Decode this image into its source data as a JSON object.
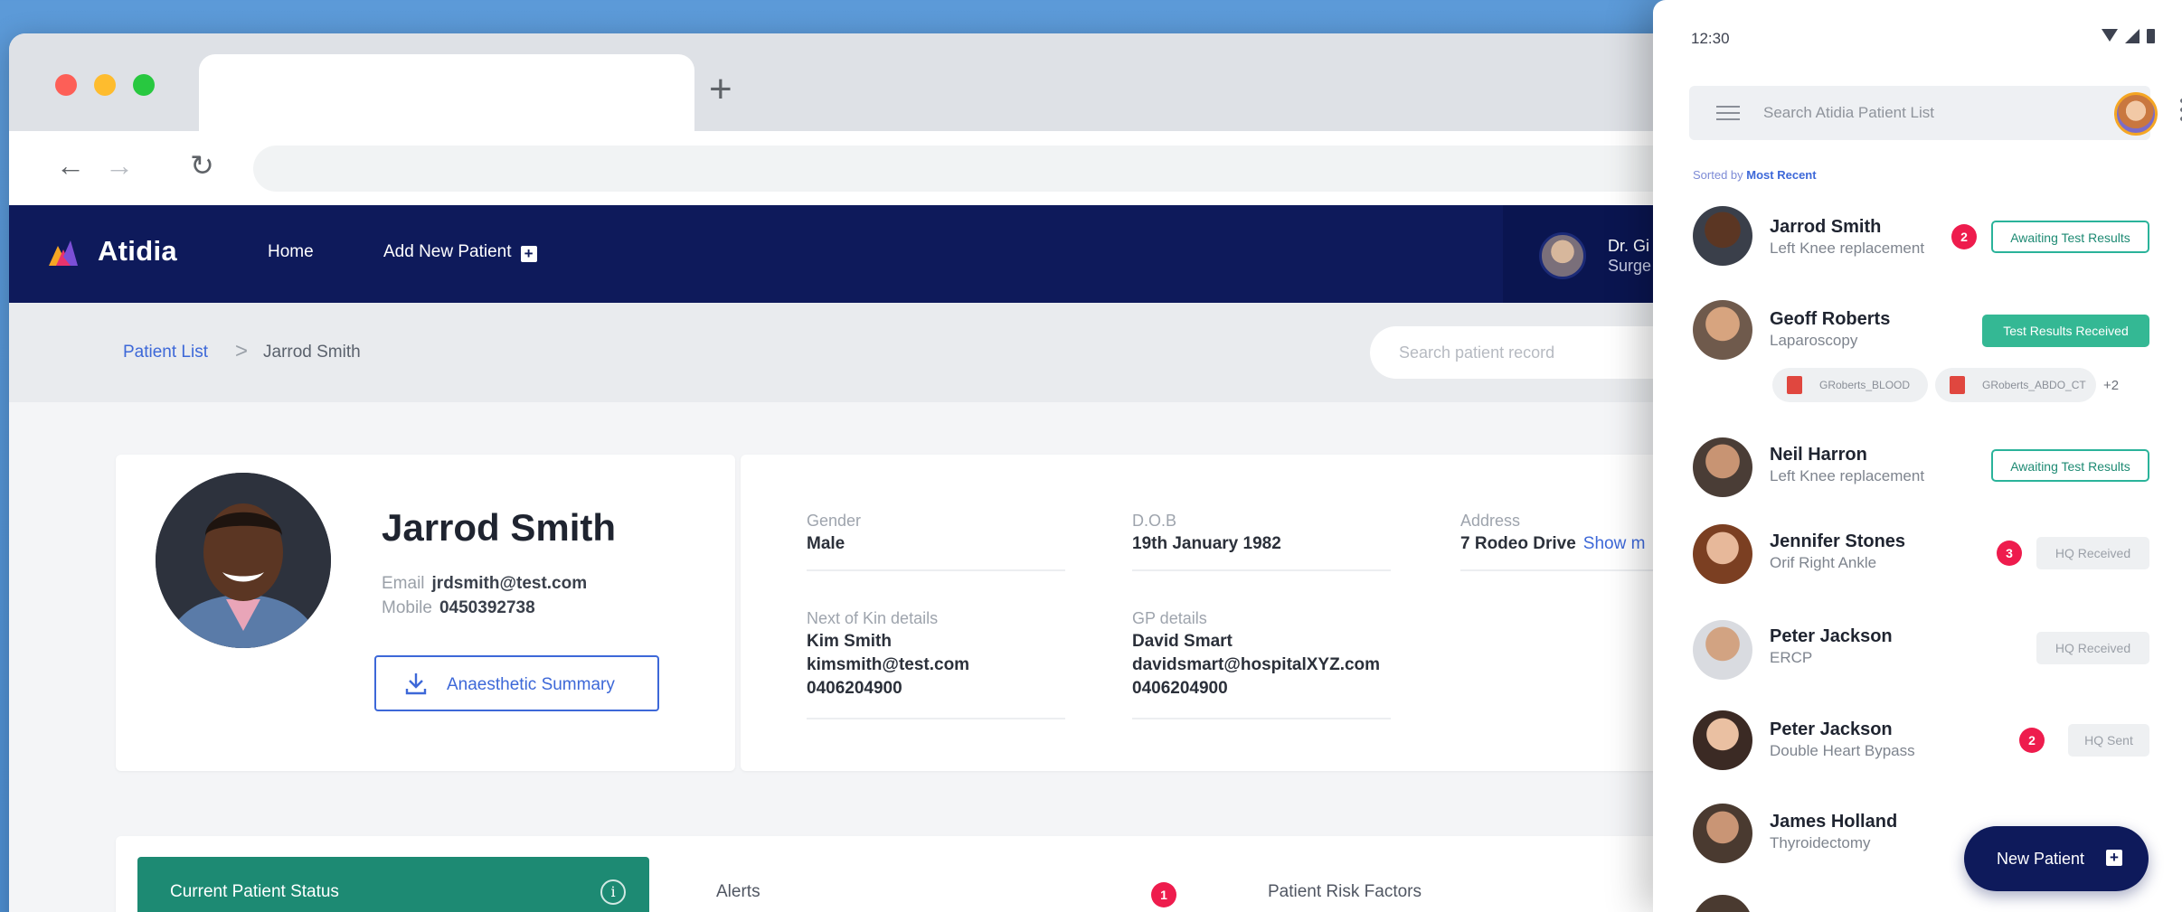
{
  "browser": {
    "new_tab": "+",
    "back": "←",
    "forward": "→",
    "reload": "↻"
  },
  "app": {
    "brand": "Atidia",
    "nav": {
      "home": "Home",
      "add_patient": "Add New Patient",
      "plus": "+"
    },
    "doctor": {
      "line1": "Dr. Gi",
      "line2": "Surge"
    }
  },
  "breadcrumb": {
    "root": "Patient List",
    "separator": ">",
    "current": "Jarrod Smith",
    "search_placeholder": "Search patient record"
  },
  "patient": {
    "name": "Jarrod Smith",
    "email_label": "Email",
    "email": "jrdsmith@test.com",
    "mobile_label": "Mobile",
    "mobile": "0450392738",
    "anaesthetic_button": "Anaesthetic Summary",
    "fields": {
      "gender_label": "Gender",
      "gender": "Male",
      "dob_label": "D.O.B",
      "dob": "19th January 1982",
      "address_label": "Address",
      "address": "7 Rodeo Drive",
      "show_more": "Show m",
      "kin_label": "Next of Kin details",
      "kin_name": "Kim Smith",
      "kin_email": "kimsmith@test.com",
      "kin_phone": "0406204900",
      "gp_label": "GP details",
      "gp_name": "David Smart",
      "gp_email": "davidsmart@hospitalXYZ.com",
      "gp_phone": "0406204900"
    }
  },
  "panels": {
    "status": "Current Patient Status",
    "info_icon": "i",
    "alerts": "Alerts",
    "alerts_count": "1",
    "risk": "Patient Risk Factors"
  },
  "mobile": {
    "time": "12:30",
    "search_placeholder": "Search Atidia Patient List",
    "sort_prefix": "Sorted by",
    "sort_value": "Most Recent",
    "patients": [
      {
        "name": "Jarrod Smith",
        "procedure": "Left Knee replacement",
        "badge": "2",
        "status": "Awaiting Test Results"
      },
      {
        "name": "Geoff Roberts",
        "procedure": "Laparoscopy",
        "status": "Test Results Received",
        "files": [
          "GRoberts_BLOOD",
          "GRoberts_ABDO_CT"
        ],
        "more_files": "+2"
      },
      {
        "name": "Neil Harron",
        "procedure": "Left Knee replacement",
        "status": "Awaiting Test Results"
      },
      {
        "name": "Jennifer Stones",
        "procedure": "Orif Right Ankle",
        "badge": "3",
        "status": "HQ Received"
      },
      {
        "name": "Peter Jackson",
        "procedure": "ERCP",
        "status": "HQ Received"
      },
      {
        "name": "Peter Jackson",
        "procedure": "Double Heart Bypass",
        "badge": "2",
        "status": "HQ Sent"
      },
      {
        "name": "James Holland",
        "procedure": "Thyroidectomy"
      }
    ],
    "fab_label": "New Patient",
    "fab_plus": "+"
  },
  "colors": {
    "navy": "#0e1a5b",
    "teal": "#1d8a73",
    "accent_blue": "#3d68d8",
    "alert_red": "#ee1c4d"
  }
}
